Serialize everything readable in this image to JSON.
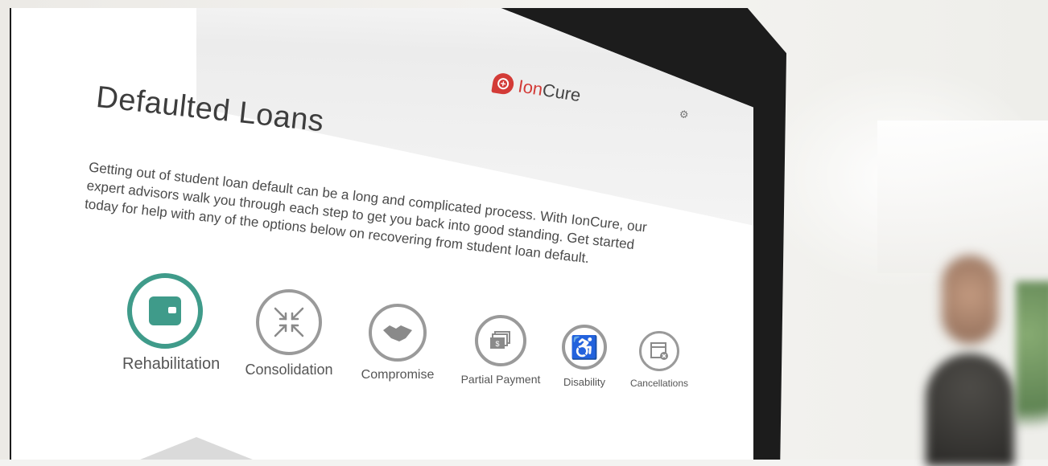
{
  "brand": {
    "logo_prefix": "Ion",
    "logo_suffix": "Cure",
    "accent": "#d33b37",
    "teal": "#3f9b8a"
  },
  "header": {
    "settings_icon": "gear-icon"
  },
  "page": {
    "title": "Defaulted Loans",
    "intro": "Getting out of student loan default can be a long and complicated process. With IonCure, our expert advisors walk you through each step to get you back into good standing. Get started today for help with any of the options below on recovering from student loan default."
  },
  "options": [
    {
      "label": "Rehabilitation",
      "icon": "wallet-icon",
      "active": true
    },
    {
      "label": "Consolidation",
      "icon": "arrows-converge-icon",
      "active": false
    },
    {
      "label": "Compromise",
      "icon": "handshake-icon",
      "active": false
    },
    {
      "label": "Partial Payment",
      "icon": "cash-stack-icon",
      "active": false
    },
    {
      "label": "Disability",
      "icon": "wheelchair-icon",
      "active": false
    },
    {
      "label": "Cancellations",
      "icon": "cancel-document-icon",
      "active": false
    }
  ]
}
